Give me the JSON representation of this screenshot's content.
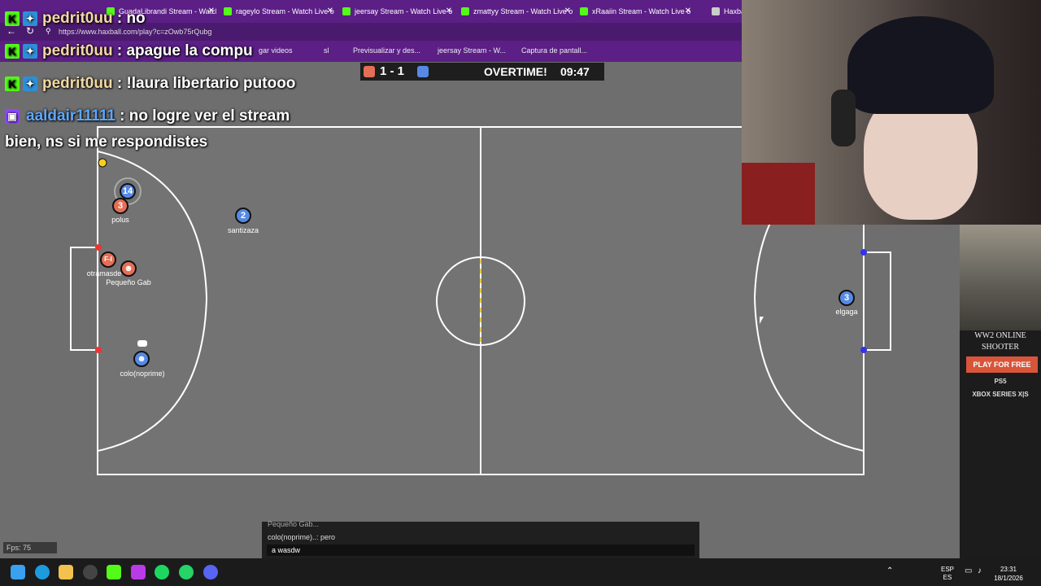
{
  "browser": {
    "tabs": [
      {
        "label": "GuadaLibrandi Stream - Watch"
      },
      {
        "label": "rageylo Stream - Watch Live o"
      },
      {
        "label": "jeersay Stream - Watch Live o"
      },
      {
        "label": "zmattyy Stream - Watch Live o"
      },
      {
        "label": "xRaaiin Stream - Watch Live o"
      },
      {
        "label": "Haxba"
      }
    ],
    "url": "https://www.haxball.com/play?c=zOwb75rQubg",
    "bookmarks": [
      {
        "label": "gar videos"
      },
      {
        "label": "sl"
      },
      {
        "label": "Previsualizar y des..."
      },
      {
        "label": "jeersay Stream - W..."
      },
      {
        "label": "Captura de pantall..."
      }
    ]
  },
  "stream_chat": [
    {
      "user": "pedrit0uu",
      "sep": " : ",
      "text": "no",
      "platform": "kick"
    },
    {
      "user": "pedrit0uu",
      "sep": " : ",
      "text": "apague la compu",
      "platform": "kick"
    },
    {
      "user": "pedrit0uu",
      "sep": " : ",
      "text": "!laura libertario putooo",
      "platform": "kick"
    },
    {
      "user": "aaldair11111",
      "sep": " : ",
      "text": "no logre ver el stream",
      "platform": "twitch"
    },
    {
      "user": "",
      "sep": "",
      "text": "bien, ns si me respondistes",
      "platform": "none"
    }
  ],
  "scoreboard": {
    "score": "1 - 1",
    "status": "OVERTIME!",
    "clock": "09:47",
    "red_color": "#e56e56",
    "blue_color": "#5689e5"
  },
  "players": [
    {
      "team": "blue",
      "number": "14",
      "name": ""
    },
    {
      "team": "red",
      "number": "3",
      "name": "polus"
    },
    {
      "team": "blue",
      "number": "2",
      "name": "santizaza"
    },
    {
      "team": "red",
      "number": "F-I",
      "name": "otramasde"
    },
    {
      "team": "red",
      "number": "☻",
      "name": "Pequeño Gab"
    },
    {
      "team": "blue",
      "number": "☻",
      "name": "colo(noprime)"
    },
    {
      "team": "blue",
      "number": "3",
      "name": "elgaga"
    }
  ],
  "ad": {
    "title": "WW2 ONLINE SHOOTER",
    "button": "PLAY FOR FREE",
    "logo1": "PS5",
    "logo2": "XBOX SERIES X|S"
  },
  "game_chat": {
    "lines": [
      "Pequeño Gab...",
      "colo(noprime)..: pero"
    ],
    "input_value": "a wasdw"
  },
  "fps": "Fps: 75",
  "taskbar": {
    "lang1": "ESP",
    "lang2": "ES",
    "time": "23:31",
    "date": "18/1/2026"
  }
}
